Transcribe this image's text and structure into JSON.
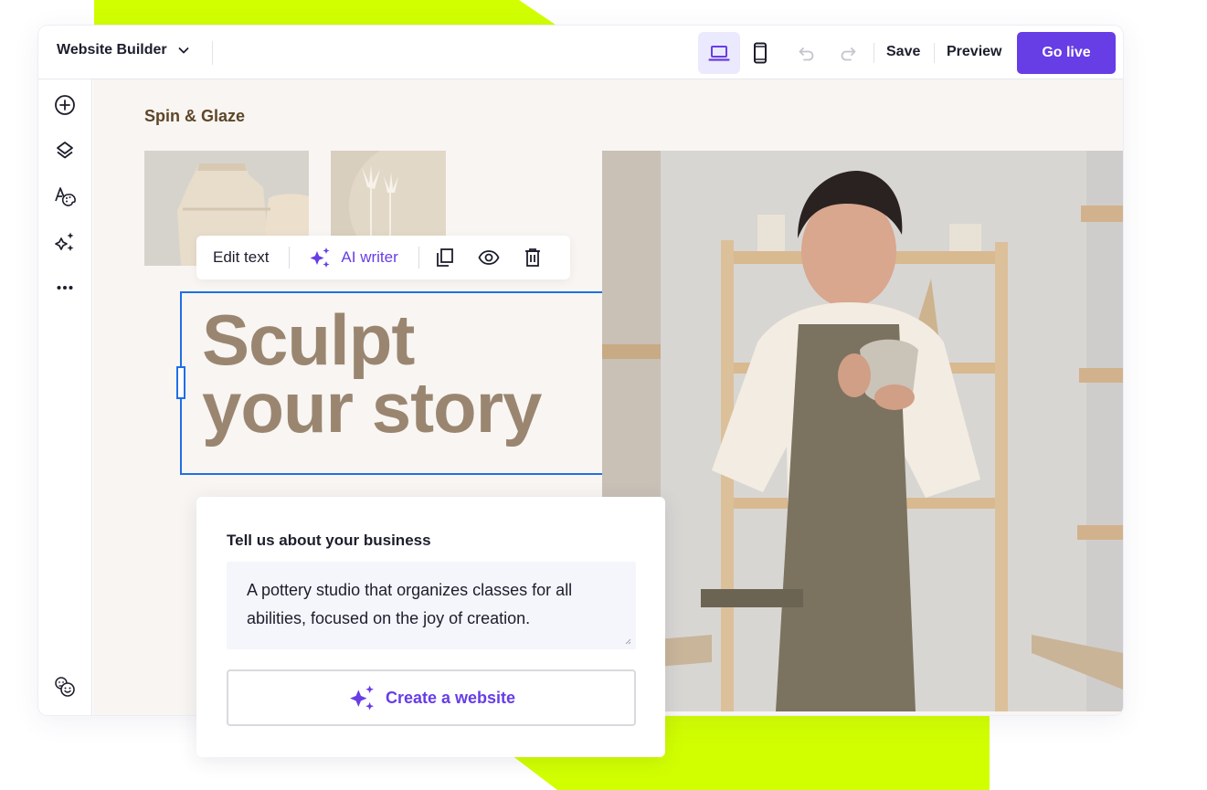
{
  "app": {
    "title": "Website Builder",
    "accent_color": "#673de6",
    "highlight_color": "#d1ff00",
    "selection_color": "#1f6fe5"
  },
  "toolbar": {
    "view_modes": [
      {
        "name": "desktop",
        "icon": "laptop-icon",
        "active": true
      },
      {
        "name": "mobile",
        "icon": "mobile-icon",
        "active": false
      }
    ],
    "undo_icon": "undo-icon",
    "redo_icon": "redo-icon",
    "save_label": "Save",
    "preview_label": "Preview",
    "go_live_label": "Go live"
  },
  "sidebar": {
    "items": [
      {
        "name": "add",
        "icon": "plus-circle-icon"
      },
      {
        "name": "layers",
        "icon": "layers-icon"
      },
      {
        "name": "styles",
        "icon": "typography-palette-icon"
      },
      {
        "name": "ai-tools",
        "icon": "sparkles-icon"
      },
      {
        "name": "more",
        "icon": "more-icon"
      }
    ],
    "bottom_item": {
      "name": "feedback",
      "icon": "smiley-faces-icon"
    }
  },
  "canvas": {
    "site_name": "Spin & Glaze",
    "headline_line1": "Sculpt",
    "headline_line2": "your story",
    "images": [
      {
        "name": "ceramic-vases-photo"
      },
      {
        "name": "dried-flowers-photo"
      },
      {
        "name": "potter-woman-photo"
      }
    ]
  },
  "edit_toolbar": {
    "edit_text_label": "Edit text",
    "ai_writer_label": "AI writer",
    "duplicate_icon": "duplicate-icon",
    "visibility_icon": "eye-icon",
    "delete_icon": "trash-icon"
  },
  "ai_card": {
    "title": "Tell us about your business",
    "description_value": "A pottery studio that organizes classes for all abilities, focused on the joy of creation.",
    "create_button_label": "Create a website"
  }
}
